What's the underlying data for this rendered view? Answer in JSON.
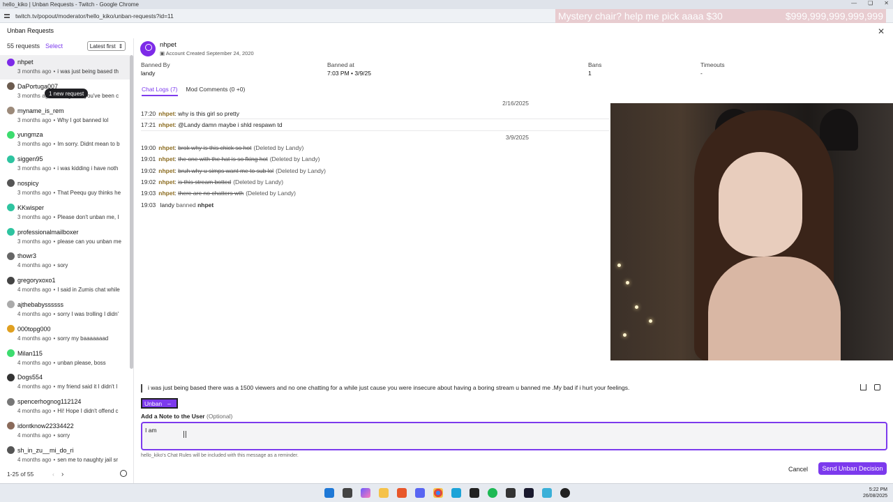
{
  "browser": {
    "title": "hello_kiko | Unban Requests - Twitch - Google Chrome",
    "url": "twitch.tv/popout/moderator/hello_kiko/unban-requests?id=11",
    "overlay_left": "Mystery chair? help me pick aaaa $30",
    "overlay_right": "$999,999,999,999,999"
  },
  "header": {
    "title": "Unban Requests"
  },
  "sidebar": {
    "count": "55 requests",
    "select": "Select",
    "sort": "Latest first",
    "new_badge": "1 new request",
    "items": [
      {
        "user": "nhpet",
        "ago": "3 months ago",
        "snippet": "i was just being based th",
        "color": "#7d2ae8"
      },
      {
        "user": "DaPortuga007",
        "ago": "3 months ago",
        "snippet": "so I guess you've been c",
        "color": "#6b5b4e"
      },
      {
        "user": "myname_is_rem",
        "ago": "3 months ago",
        "snippet": "Why I got banned lol",
        "color": "#9c8a7a"
      },
      {
        "user": "yungmza",
        "ago": "3 months ago",
        "snippet": "Im sorry. Didnt mean to b",
        "color": "#3ddc6f"
      },
      {
        "user": "siggen95",
        "ago": "3 months ago",
        "snippet": "i was kidding i have noth",
        "color": "#2ec4a0"
      },
      {
        "user": "nospicy",
        "ago": "3 months ago",
        "snippet": "That Peequ guy thinks he",
        "color": "#555555"
      },
      {
        "user": "KKwisper",
        "ago": "3 months ago",
        "snippet": "Please don't unban me, I",
        "color": "#2ec4a0"
      },
      {
        "user": "professionalmailboxer",
        "ago": "3 months ago",
        "snippet": "please can you unban me",
        "color": "#2ec4a0"
      },
      {
        "user": "thowr3",
        "ago": "4 months ago",
        "snippet": "sory",
        "color": "#666666"
      },
      {
        "user": "gregoryxoxo1",
        "ago": "4 months ago",
        "snippet": "I said in Zumis chat while",
        "color": "#444444"
      },
      {
        "user": "ajthebabyssssss",
        "ago": "4 months ago",
        "snippet": "sorry I was trolling I didn'",
        "color": "#aaaaaa"
      },
      {
        "user": "000topg000",
        "ago": "4 months ago",
        "snippet": "sorry my baaaaaaad",
        "color": "#e0a020"
      },
      {
        "user": "Milan115",
        "ago": "4 months ago",
        "snippet": "unban please, boss",
        "color": "#3ddc6f"
      },
      {
        "user": "Dogs554",
        "ago": "4 months ago",
        "snippet": "my friend said it I didn't I",
        "color": "#333333"
      },
      {
        "user": "spencerhognog112124",
        "ago": "4 months ago",
        "snippet": "Hi! Hope I didn't offend c",
        "color": "#777777"
      },
      {
        "user": "idontknow22334422",
        "ago": "4 months ago",
        "snippet": "sorry",
        "color": "#8a6a5a"
      },
      {
        "user": "sh_in_zu__mi_do_ri",
        "ago": "4 months ago",
        "snippet": "sen me to naughty jail sr",
        "color": "#555555"
      }
    ],
    "pager": "1-25 of 55",
    "prev": "‹",
    "next": "›"
  },
  "user": {
    "name": "nhpet",
    "created": "Account Created September 24, 2020"
  },
  "stats": [
    {
      "label": "Banned By",
      "value": "landy"
    },
    {
      "label": "Banned at",
      "value": "7:03 PM • 3/9/25"
    },
    {
      "label": "Bans",
      "value": "1"
    },
    {
      "label": "Timeouts",
      "value": "-"
    }
  ],
  "tabs": [
    {
      "label": "Chat Logs (7)"
    },
    {
      "label": "Mod Comments (0 +0)"
    }
  ],
  "chat": {
    "date1": "2/16/2025",
    "date2": "3/9/2025",
    "day1": [
      {
        "time": "17:20",
        "author": "nhpet",
        "text": "why is this girl so pretty"
      },
      {
        "time": "17:21",
        "author": "nhpet",
        "text": "@Landy damn maybe i shld respawn td"
      }
    ],
    "day2": [
      {
        "time": "19:00",
        "author": "nhpet",
        "text": "brok why is this chick so hot",
        "note": "(Deleted by Landy)"
      },
      {
        "time": "19:01",
        "author": "nhpet",
        "text": "the one with the hat is so fking hot",
        "note": "(Deleted by Landy)"
      },
      {
        "time": "19:02",
        "author": "nhpet",
        "text": "bruh why u simps want me to sub lol",
        "note": "(Deleted by Landy)"
      },
      {
        "time": "19:02",
        "author": "nhpet",
        "text": "is this stream botted",
        "note": "(Deleted by Landy)"
      },
      {
        "time": "19:03",
        "author": "nhpet",
        "text": "there are no chatters wth",
        "note": "(Deleted by Landy)"
      }
    ],
    "ban_time": "19:03",
    "ban_mod": "landy",
    "ban_verb": "banned",
    "ban_user": "nhpet"
  },
  "request_message": "i was just being based there was a 1500 viewers and no one chatting for a while just cause you were insecure about having a boring stream u banned me .My bad if i hurt your feelings.",
  "decision": {
    "unban_label": "Unban",
    "unban_symbol": "–",
    "note_label": "Add a Note to the User",
    "note_optional": "(Optional)",
    "note_value": "I am ",
    "rules_note": "hello_kiko's Chat Rules will be included with this message as a reminder.",
    "cancel": "Cancel",
    "send": "Send Unban Decision"
  },
  "taskbar": {
    "time": "5:22 PM",
    "date": "26/08/2025"
  },
  "colors": {
    "accent": "#7c3aed",
    "author": "#8b6b1e"
  }
}
